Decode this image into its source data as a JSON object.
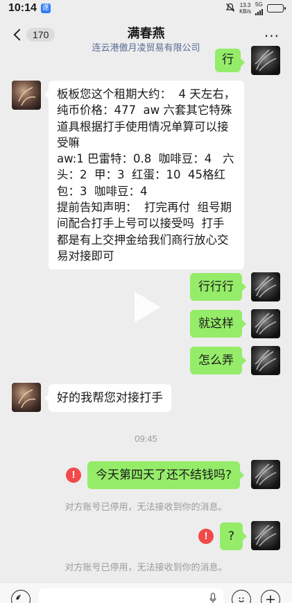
{
  "status_bar": {
    "time": "10:14",
    "app_icon": "遂",
    "net_speed_value": "13.3",
    "net_speed_unit": "KB/s",
    "network": "5G",
    "battery_level": 0.95
  },
  "header": {
    "back_count": "170",
    "title": "满春燕",
    "subtitle": "连云港傲月凌贸易有限公司",
    "more": "···"
  },
  "messages": {
    "m1_self": "行",
    "m2_other_lines": [
      "板板您这个租期大约：  4 天左右，",
      "纯币价格：477  aw 六套其它特殊",
      "道具根据打手使用情况单算可以接",
      "受嘛",
      "aw:1 巴雷特：0.8  咖啡豆：4   六",
      "头：2  甲：3  红蛋：10  45格红",
      "包：3  咖啡豆：4",
      "提前告知声明：  打完再付  组号期",
      "间配合打手上号可以接受吗  打手",
      "都是有上交押金给我们商行放心交",
      "易对接即可"
    ],
    "m3_self": "行行行",
    "m4_self": "就这样",
    "m5_self": "怎么弄",
    "m6_other": "好的我帮您对接打手",
    "time_label": "09:45",
    "m7_self": "今天第四天了还不结钱吗?",
    "m8_self": "?",
    "fail_mark": "!",
    "system_notice": "对方账号已停用，无法接收到你的消息。"
  },
  "input_bar": {
    "voice_icon": "voice-icon",
    "emoji_icon": "emoji-icon",
    "plus_icon": "plus-icon"
  }
}
